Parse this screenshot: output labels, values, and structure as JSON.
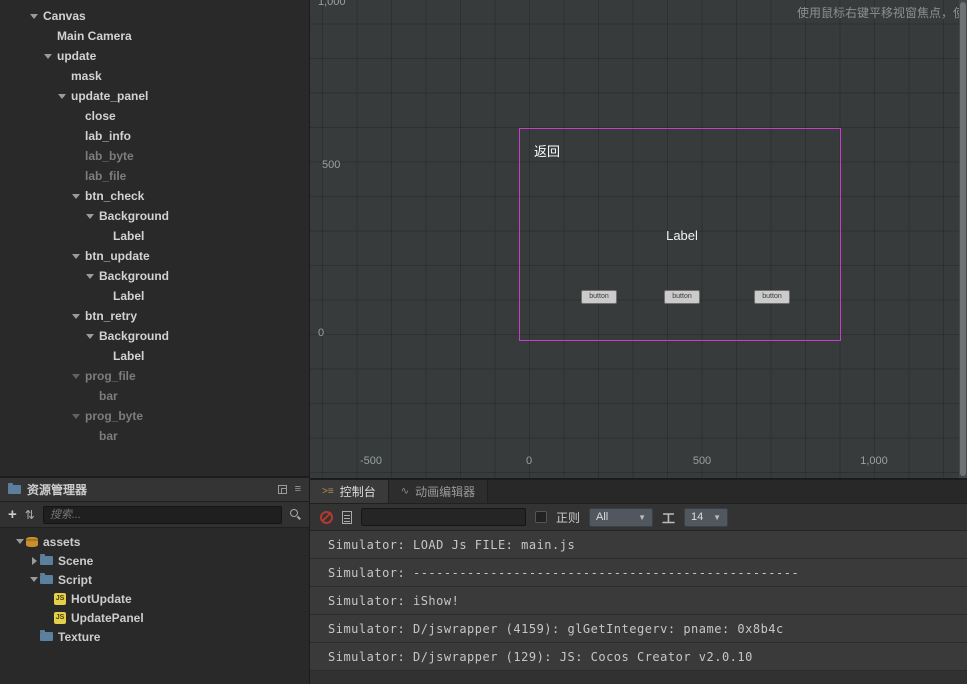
{
  "hierarchy": {
    "items": [
      {
        "label": "Canvas",
        "level": 0,
        "arrow": "down",
        "disabled": false
      },
      {
        "label": "Main Camera",
        "level": 1,
        "arrow": "none",
        "disabled": false
      },
      {
        "label": "update",
        "level": 1,
        "arrow": "down",
        "disabled": false
      },
      {
        "label": "mask",
        "level": 2,
        "arrow": "none",
        "disabled": false
      },
      {
        "label": "update_panel",
        "level": 2,
        "arrow": "down",
        "disabled": false
      },
      {
        "label": "close",
        "level": 3,
        "arrow": "none",
        "disabled": false
      },
      {
        "label": "lab_info",
        "level": 3,
        "arrow": "none",
        "disabled": false
      },
      {
        "label": "lab_byte",
        "level": 3,
        "arrow": "none",
        "disabled": true
      },
      {
        "label": "lab_file",
        "level": 3,
        "arrow": "none",
        "disabled": true
      },
      {
        "label": "btn_check",
        "level": 3,
        "arrow": "down",
        "disabled": false
      },
      {
        "label": "Background",
        "level": 4,
        "arrow": "down",
        "disabled": false
      },
      {
        "label": "Label",
        "level": 5,
        "arrow": "none",
        "disabled": false
      },
      {
        "label": "btn_update",
        "level": 3,
        "arrow": "down",
        "disabled": false
      },
      {
        "label": "Background",
        "level": 4,
        "arrow": "down",
        "disabled": false
      },
      {
        "label": "Label",
        "level": 5,
        "arrow": "none",
        "disabled": false
      },
      {
        "label": "btn_retry",
        "level": 3,
        "arrow": "down",
        "disabled": false
      },
      {
        "label": "Background",
        "level": 4,
        "arrow": "down",
        "disabled": false
      },
      {
        "label": "Label",
        "level": 5,
        "arrow": "none",
        "disabled": false
      },
      {
        "label": "prog_file",
        "level": 3,
        "arrow": "down",
        "disabled": true
      },
      {
        "label": "bar",
        "level": 4,
        "arrow": "none",
        "disabled": true
      },
      {
        "label": "prog_byte",
        "level": 3,
        "arrow": "down",
        "disabled": true
      },
      {
        "label": "bar",
        "level": 4,
        "arrow": "none",
        "disabled": true
      }
    ]
  },
  "assets": {
    "title": "资源管理器",
    "search_placeholder": "搜索...",
    "tree": [
      {
        "label": "assets",
        "level": 0,
        "arrow": "down",
        "icon": "db"
      },
      {
        "label": "Scene",
        "level": 1,
        "arrow": "right",
        "icon": "folder"
      },
      {
        "label": "Script",
        "level": 1,
        "arrow": "down",
        "icon": "folder"
      },
      {
        "label": "HotUpdate",
        "level": 2,
        "arrow": "none",
        "icon": "js"
      },
      {
        "label": "UpdatePanel",
        "level": 2,
        "arrow": "none",
        "icon": "js"
      },
      {
        "label": "Texture",
        "level": 1,
        "arrow": "none",
        "icon": "folder"
      }
    ]
  },
  "scene": {
    "hint": "使用鼠标右键平移视窗焦点，使用",
    "v_ruler": [
      "1,000",
      "500",
      "0"
    ],
    "h_ruler": [
      "-500",
      "0",
      "500",
      "1,000"
    ],
    "canvas_labels": {
      "back": "返回",
      "center": "Label",
      "button": "button"
    },
    "accent_color": "#c93ec9"
  },
  "console": {
    "tabs": [
      {
        "label": "控制台"
      },
      {
        "label": "动画编辑器"
      }
    ],
    "regex_label": "正则",
    "filter_value": "All",
    "font_size": "14",
    "logs": [
      "Simulator: LOAD Js FILE: main.js",
      "Simulator: --------------------------------------------------",
      "Simulator: iShow!",
      "Simulator: D/jswrapper (4159): glGetIntegerv: pname: 0x8b4c",
      "Simulator: D/jswrapper (129): JS: Cocos Creator v2.0.10"
    ]
  }
}
